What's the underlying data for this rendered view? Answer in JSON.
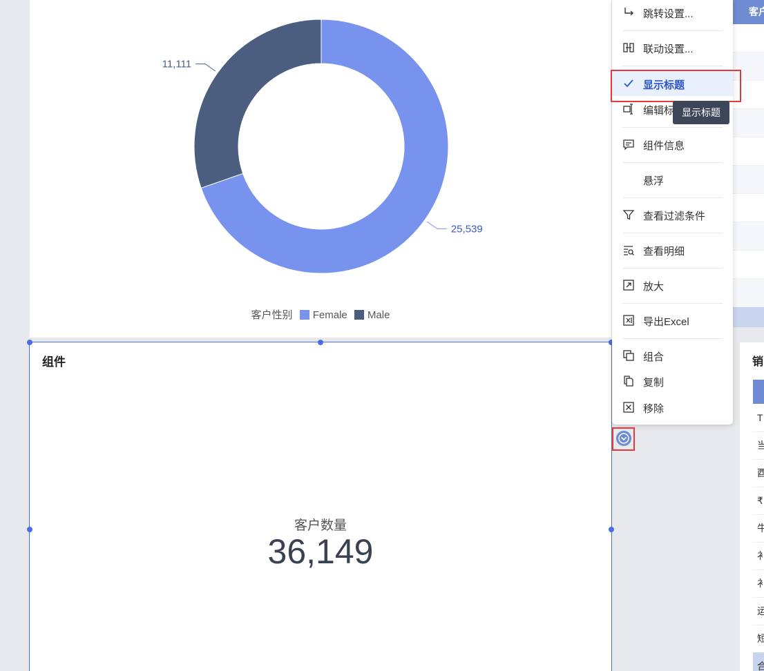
{
  "donut_chart": {
    "legend_title": "客户性别",
    "chart_data": {
      "type": "pie",
      "categories": [
        "Female",
        "Male"
      ],
      "values": [
        25539,
        11111
      ],
      "value_labels": [
        "25,539",
        "11,111"
      ],
      "colors": [
        "#7893ee",
        "#4b5e80"
      ],
      "legend_placement": "bottom",
      "donut": true
    }
  },
  "component_card": {
    "title": "组件",
    "kpi_label": "客户数量",
    "kpi_value": "36,149"
  },
  "background_table": {
    "header_text": "客户",
    "right_card_title": "销",
    "right_card_cells": [
      "T",
      "当",
      "酉",
      "₹",
      "牛",
      "衤",
      "衤",
      "运",
      "短",
      "合"
    ]
  },
  "context_menu": {
    "items": [
      {
        "label": "跳转设置...",
        "icon": "redirect-icon"
      },
      {
        "label": "联动设置...",
        "icon": "link-icon"
      },
      {
        "label": "显示标题",
        "icon": "check-icon"
      },
      {
        "label": "编辑标题",
        "icon": "edit-title-icon"
      },
      {
        "label": "组件信息",
        "icon": "comment-icon"
      },
      {
        "label": "悬浮",
        "icon": ""
      },
      {
        "label": "查看过滤条件",
        "icon": "filter-icon"
      },
      {
        "label": "查看明细",
        "icon": "detail-icon"
      },
      {
        "label": "放大",
        "icon": "expand-icon"
      },
      {
        "label": "导出Excel",
        "icon": "excel-icon"
      },
      {
        "label": "组合",
        "icon": "group-icon"
      },
      {
        "label": "复制",
        "icon": "copy-icon"
      },
      {
        "label": "移除",
        "icon": "remove-icon"
      }
    ],
    "edit_title_visible": "编辑标",
    "tooltip": "显示标题"
  },
  "colors": {
    "accent": "#4a6de5",
    "highlight_red": "#e33b3b"
  }
}
